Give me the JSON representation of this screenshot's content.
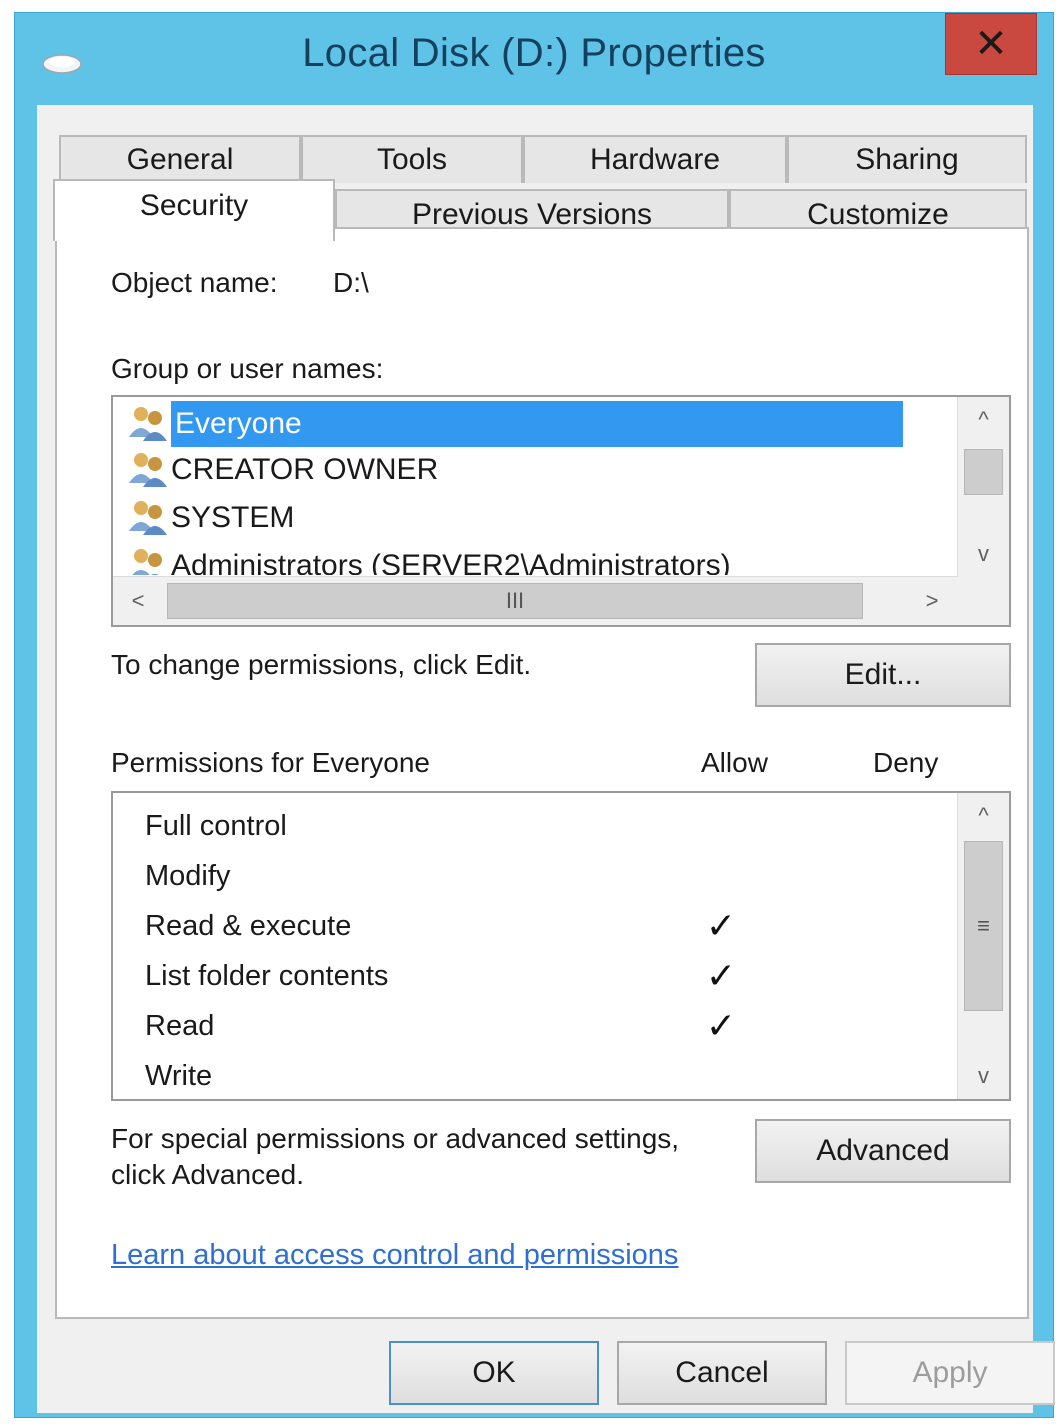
{
  "window": {
    "title": "Local Disk (D:) Properties",
    "close_glyph": "✕"
  },
  "tabs": {
    "row1": [
      {
        "label": "General"
      },
      {
        "label": "Tools"
      },
      {
        "label": "Hardware"
      },
      {
        "label": "Sharing"
      }
    ],
    "row2": [
      {
        "label": "Security",
        "active": true
      },
      {
        "label": "Previous Versions"
      },
      {
        "label": "Customize"
      }
    ]
  },
  "security": {
    "object_name_label": "Object name:",
    "object_name_value": "D:\\",
    "group_label": "Group or user names:",
    "users": [
      {
        "name": "Everyone",
        "selected": true
      },
      {
        "name": "CREATOR OWNER"
      },
      {
        "name": "SYSTEM"
      },
      {
        "name": "Administrators (SERVER2\\Administrators)"
      }
    ],
    "scroll_left": "<",
    "scroll_right": ">",
    "scroll_up": "^",
    "scroll_down": "v",
    "hthumb_grip": "III",
    "vthumb_grip": "≡",
    "change_text": "To change permissions, click Edit.",
    "edit_button": "Edit...",
    "permissions_label": "Permissions for Everyone",
    "allow_header": "Allow",
    "deny_header": "Deny",
    "check_glyph": "✓",
    "permissions": [
      {
        "name": "Full control",
        "allow": false,
        "deny": false
      },
      {
        "name": "Modify",
        "allow": false,
        "deny": false
      },
      {
        "name": "Read & execute",
        "allow": true,
        "deny": false
      },
      {
        "name": "List folder contents",
        "allow": true,
        "deny": false
      },
      {
        "name": "Read",
        "allow": true,
        "deny": false
      },
      {
        "name": "Write",
        "allow": false,
        "deny": false
      }
    ],
    "special_text_line1": "For special permissions or advanced settings,",
    "special_text_line2": "click Advanced.",
    "advanced_button": "Advanced",
    "learn_link": "Learn about access control and permissions"
  },
  "footer": {
    "ok": "OK",
    "cancel": "Cancel",
    "apply": "Apply"
  },
  "colors": {
    "titlebar": "#5fc3e8",
    "close": "#c9483f",
    "selection": "#3399f0",
    "link": "#2f6fcf"
  }
}
